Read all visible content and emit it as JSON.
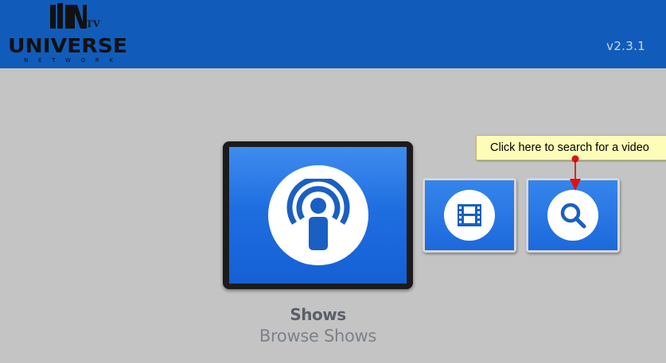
{
  "header": {
    "logo": {
      "mark": "UN",
      "tv": "TV",
      "name": "UNIVERSE",
      "subtitle": "NETWORK"
    },
    "version": "v2.3.1",
    "colors": {
      "background": "#115cba",
      "version_text": "#c9d6ea"
    }
  },
  "main": {
    "background": "#c4c4c4",
    "tiles": [
      {
        "id": "shows",
        "icon": "podcast-icon",
        "selected": true
      },
      {
        "id": "movies",
        "icon": "film-strip-icon",
        "selected": false
      },
      {
        "id": "search",
        "icon": "magnifier-icon",
        "selected": false
      }
    ],
    "focused": {
      "title": "Shows",
      "subtitle": "Browse Shows"
    },
    "colors": {
      "tile_blue": "#1c69dc",
      "icon_blue": "#1a5fc2"
    }
  },
  "annotation": {
    "tooltip": "Click here to search for a video",
    "colors": {
      "tooltip_bg": "#fdfdb8",
      "pointer": "#e01010"
    }
  }
}
